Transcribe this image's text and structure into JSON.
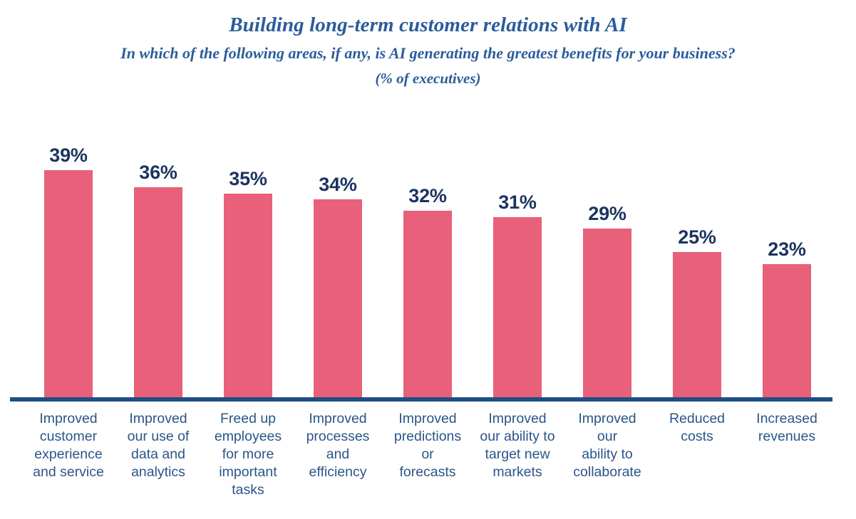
{
  "header": {
    "title": "Building long-term customer relations with AI",
    "subtitle": "In which of the following areas, if any, is AI generating the greatest benefits for your business?",
    "note": "(% of executives)"
  },
  "colors": {
    "bar": "#E8607A",
    "title_blue": "#2B5C9B",
    "label_blue": "#2A5589",
    "value_navy": "#1B3460",
    "axis_navy": "#1F4E82",
    "background": "#FFFFFF"
  },
  "chart_data": {
    "type": "bar",
    "title": "Building long-term customer relations with AI",
    "subtitle": "In which of the following areas, if any, is AI generating the greatest benefits for your business?",
    "annotation": "(% of executives)",
    "xlabel": "",
    "ylabel": "",
    "ylim": [
      0,
      42
    ],
    "grid": false,
    "legend": "none",
    "unit": "%",
    "categories": [
      "Improved customer experience and service",
      "Improved our use of data and analytics",
      "Freed up employees for more important tasks",
      "Improved processes and efficiency",
      "Improved predictions or forecasts",
      "Improved our ability to target new markets",
      "Improved our ability to collaborate",
      "Reduced costs",
      "Increased revenues"
    ],
    "category_lines": [
      [
        "Improved",
        "customer",
        "experience",
        "and service"
      ],
      [
        "Improved",
        "our use of",
        "data and",
        "analytics"
      ],
      [
        "Freed up",
        "employees",
        "for more",
        "important",
        "tasks"
      ],
      [
        "Improved",
        "processes",
        "and",
        "efficiency"
      ],
      [
        "Improved",
        "predictions",
        "or",
        "forecasts"
      ],
      [
        "Improved",
        "our ability to",
        "target new",
        "markets"
      ],
      [
        "Improved",
        "our",
        "ability to",
        "collaborate"
      ],
      [
        "Reduced",
        "costs"
      ],
      [
        "Increased",
        "revenues"
      ]
    ],
    "values": [
      39,
      36,
      35,
      34,
      32,
      31,
      29,
      25,
      23
    ],
    "value_labels": [
      "39%",
      "36%",
      "35%",
      "34%",
      "32%",
      "31%",
      "29%",
      "25%",
      "23%"
    ]
  }
}
